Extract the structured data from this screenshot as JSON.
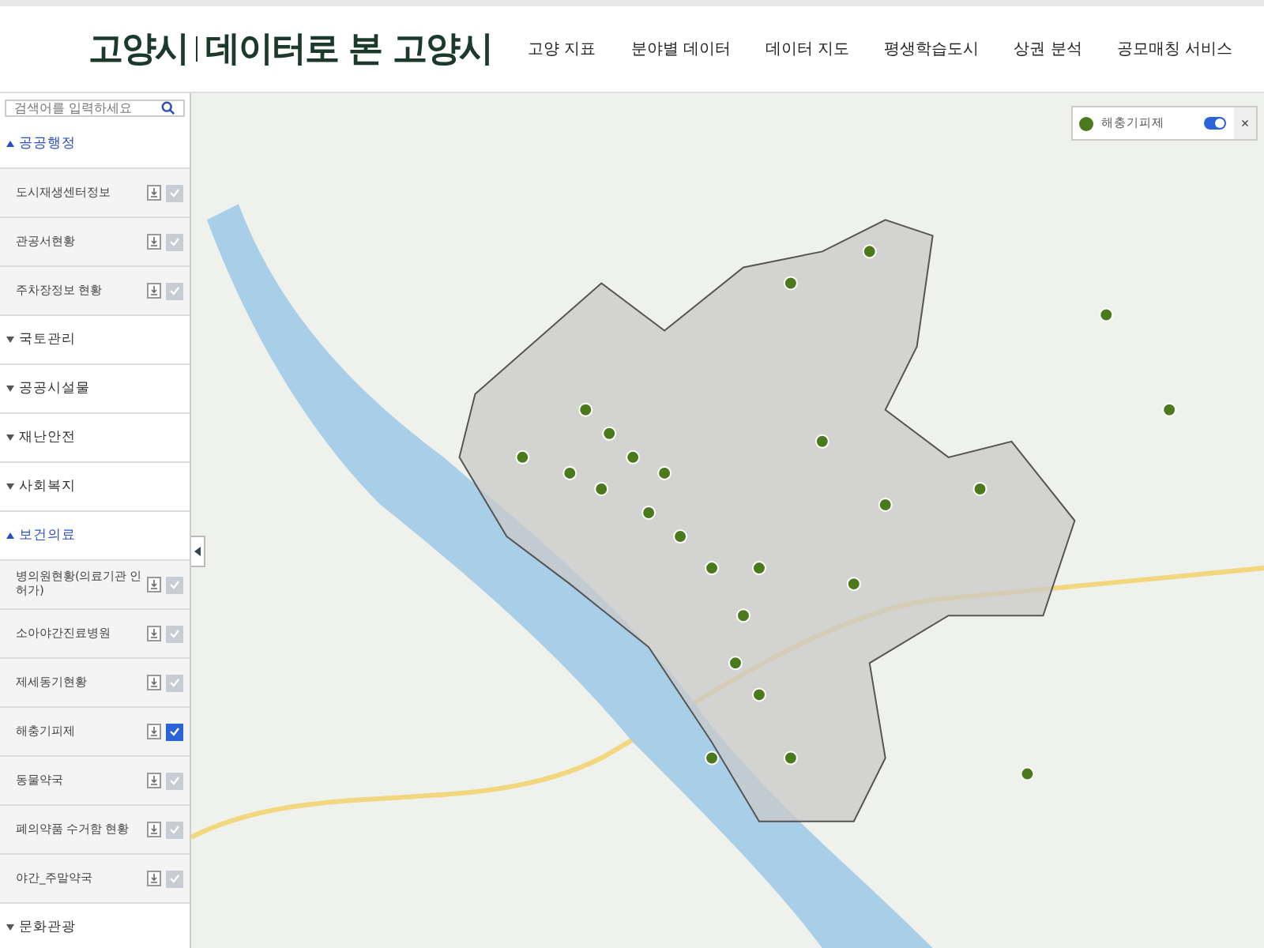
{
  "header": {
    "logo": "고양시",
    "subtitle": "데이터로 본 고양시",
    "nav": [
      {
        "label": "고양 지표"
      },
      {
        "label": "분야별 데이터"
      },
      {
        "label": "데이터 지도"
      },
      {
        "label": "평생학습도시"
      },
      {
        "label": "상권 분석"
      },
      {
        "label": "공모매칭 서비스"
      }
    ]
  },
  "sidebar": {
    "search": {
      "placeholder": "검색어를 입력하세요"
    },
    "categories": [
      {
        "label": "공공행정",
        "expanded": true,
        "items": [
          {
            "label": "도시재생센터정보",
            "checked": false
          },
          {
            "label": "관공서현황",
            "checked": false
          },
          {
            "label": "주차장정보 현황",
            "checked": false
          }
        ]
      },
      {
        "label": "국토관리",
        "expanded": false
      },
      {
        "label": "공공시설물",
        "expanded": false
      },
      {
        "label": "재난안전",
        "expanded": false
      },
      {
        "label": "사회복지",
        "expanded": false
      },
      {
        "label": "보건의료",
        "expanded": true,
        "items": [
          {
            "label": "병의원현황(의료기관 인허가)",
            "checked": false
          },
          {
            "label": "소아야간진료병원",
            "checked": false
          },
          {
            "label": "제세동기현황",
            "checked": false
          },
          {
            "label": "해충기피제",
            "checked": true
          },
          {
            "label": "동물약국",
            "checked": false
          },
          {
            "label": "폐의약품 수거함 현황",
            "checked": false
          },
          {
            "label": "야간_주말약국",
            "checked": false
          }
        ]
      },
      {
        "label": "문화관광",
        "expanded": false
      }
    ]
  },
  "map": {
    "layers": [
      {
        "label": "해충기피제",
        "on": true,
        "color": "#4a7a1c"
      }
    ],
    "close": "×"
  }
}
